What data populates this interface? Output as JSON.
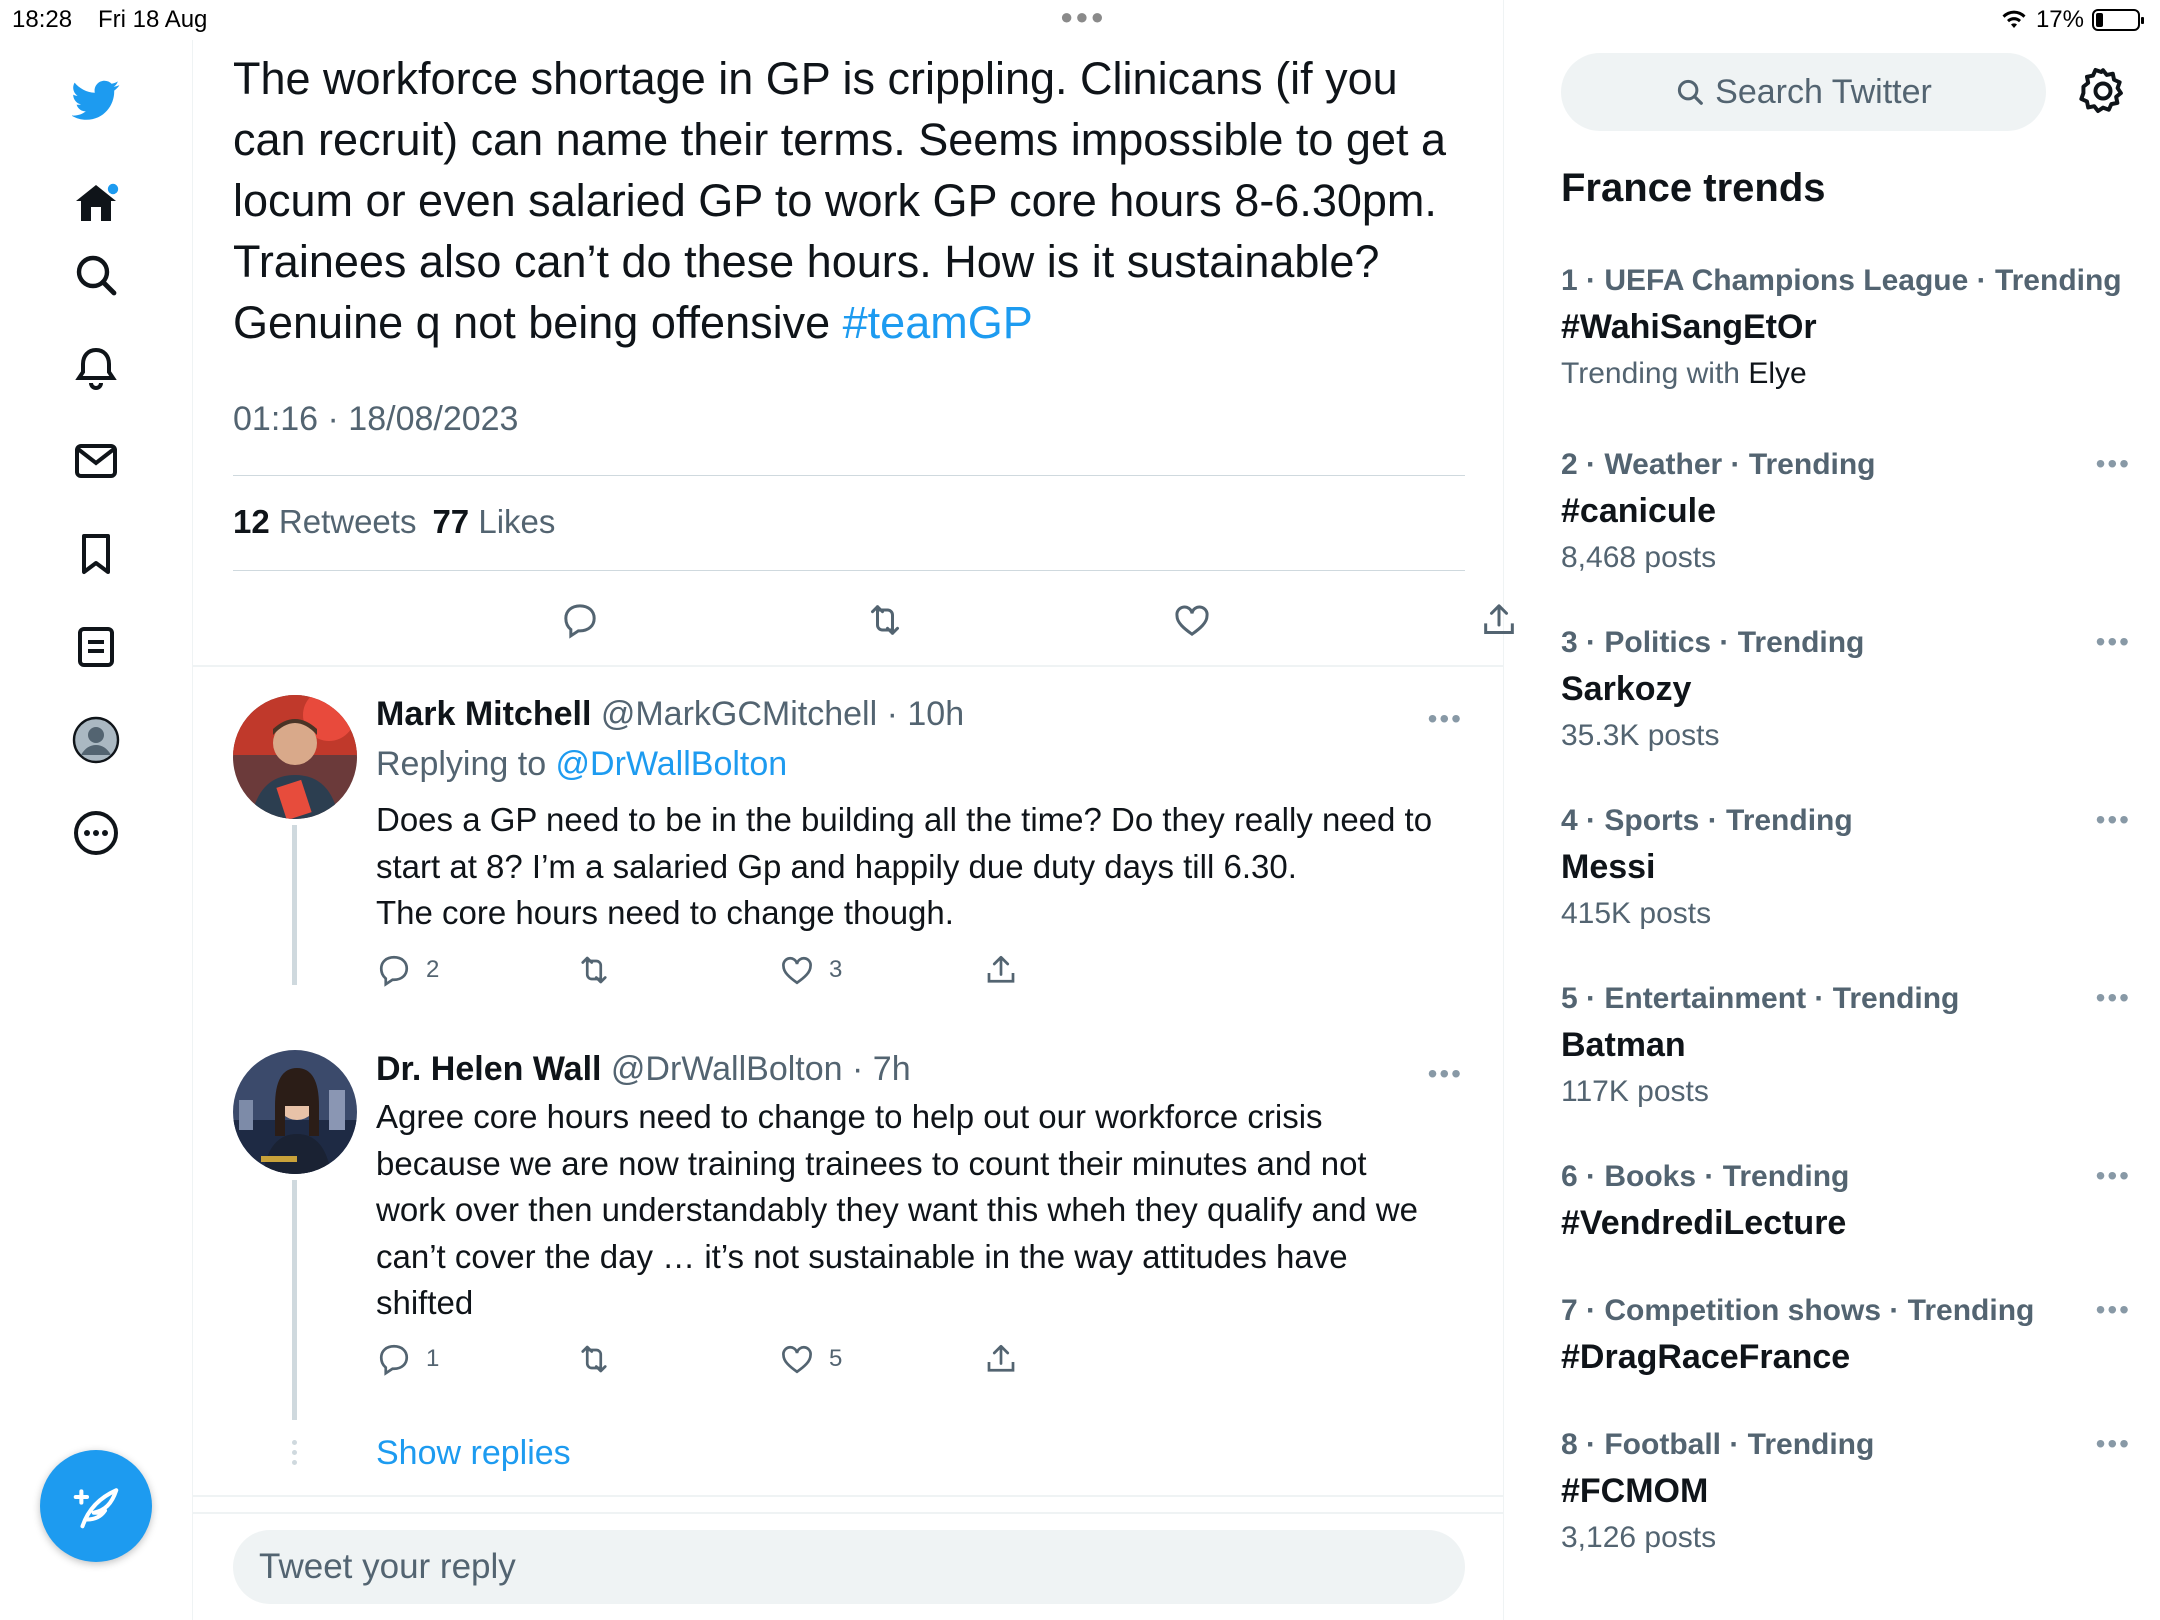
{
  "status": {
    "time": "18:28",
    "date": "Fri 18 Aug",
    "battery_percent": "17%",
    "battery_level": 0.17
  },
  "colors": {
    "accent": "#1d9bf0",
    "secondary_text": "#536471",
    "primary_text": "#0f1419"
  },
  "tweet": {
    "text": "The workforce shortage in GP is crippling. Clinicans (if you can recruit) can name their terms. Seems impossible to get a locum or even salaried GP to work GP core hours 8-6.30pm. Trainees also can’t do these hours. How is it sustainable? Genuine q not being offensive ",
    "hashtag": "#teamGP",
    "timestamp": "01:16 · 18/08/2023",
    "retweets_count": "12",
    "retweets_label": "Retweets",
    "likes_count": "77",
    "likes_label": "Likes"
  },
  "replies": [
    {
      "name": "Mark Mitchell",
      "handle_time": "@MarkGCMitchell · 10h",
      "replying_prefix": "Replying to ",
      "replying_to": "@DrWallBolton",
      "body_lines": [
        "Does a GP need to be in the building all the time? Do they really need to",
        "start at 8? I’m a salaried Gp and happily due duty days till 6.30.",
        "The core hours need to change though."
      ],
      "reply_count": "2",
      "retweet_count": "",
      "like_count": "3"
    },
    {
      "name": "Dr. Helen Wall",
      "handle_time": "@DrWallBolton · 7h",
      "body_lines": [
        "Agree core hours need to change to help out our workforce crisis",
        "because we are now training trainees to count their minutes and not",
        "work over then understandably they want this wheh they qualify and we",
        "can’t cover the day … it’s not sustainable in the way attitudes have",
        "shifted"
      ],
      "reply_count": "1",
      "retweet_count": "",
      "like_count": "5"
    }
  ],
  "show_replies": "Show replies",
  "reply_box": {
    "placeholder": "Tweet your reply"
  },
  "search": {
    "placeholder": "Search Twitter"
  },
  "trends": {
    "title": "France trends",
    "items": [
      {
        "rank": "1",
        "category": "UEFA Champions League · Trending",
        "name": "#WahiSangEtOr",
        "sub_prefix": "Trending with ",
        "sub_value": "Elye"
      },
      {
        "rank": "2",
        "category": "Weather · Trending",
        "name": "#canicule",
        "sub_prefix": "8,468 posts",
        "sub_value": ""
      },
      {
        "rank": "3",
        "category": "Politics · Trending",
        "name": "Sarkozy",
        "sub_prefix": "35.3K posts",
        "sub_value": ""
      },
      {
        "rank": "4",
        "category": "Sports · Trending",
        "name": "Messi",
        "sub_prefix": "415K posts",
        "sub_value": ""
      },
      {
        "rank": "5",
        "category": "Entertainment · Trending",
        "name": "Batman",
        "sub_prefix": "117K posts",
        "sub_value": ""
      },
      {
        "rank": "6",
        "category": "Books · Trending",
        "name": "#VendrediLecture",
        "sub_prefix": "",
        "sub_value": ""
      },
      {
        "rank": "7",
        "category": "Competition shows · Trending",
        "name": "#DragRaceFrance",
        "sub_prefix": "",
        "sub_value": ""
      },
      {
        "rank": "8",
        "category": "Football · Trending",
        "name": "#FCMOM",
        "sub_prefix": "3,126 posts",
        "sub_value": ""
      }
    ]
  },
  "icons": {
    "nav": [
      "twitter-logo-icon",
      "home-icon",
      "search-icon",
      "bell-icon",
      "mail-icon",
      "bookmark-icon",
      "lists-icon",
      "profile-icon",
      "more-icon"
    ],
    "compose": "compose-icon"
  }
}
